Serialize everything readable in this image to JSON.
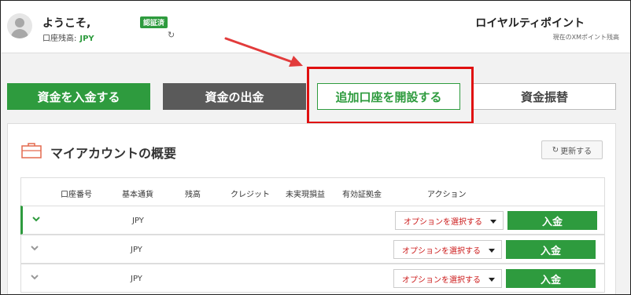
{
  "header": {
    "welcome": "ようこそ,",
    "verified_badge": "認証済",
    "balance_label": "口座残高:",
    "balance_currency": "JPY",
    "points_title": "ロイヤルティポイント",
    "points_subtitle": "現在のXMポイント残高"
  },
  "actions": {
    "deposit": "資金を入金する",
    "withdraw": "資金の出金",
    "open_account": "追加口座を開設する",
    "transfer": "資金振替"
  },
  "panel": {
    "title": "マイアカウントの概要",
    "refresh": "更新する"
  },
  "table": {
    "headers": [
      "口座番号",
      "基本通貨",
      "残高",
      "クレジット",
      "未実現損益",
      "有効証拠金",
      "アクション"
    ],
    "rows": [
      {
        "currency": "JPY",
        "option": "オプションを選択する",
        "button": "入金"
      },
      {
        "currency": "JPY",
        "option": "オプションを選択する",
        "button": "入金"
      },
      {
        "currency": "JPY",
        "option": "オプションを選択する",
        "button": "入金"
      }
    ]
  },
  "colors": {
    "brand_green": "#2e9b3e",
    "highlight_red": "#e01010",
    "option_red": "#cc1a1a"
  }
}
